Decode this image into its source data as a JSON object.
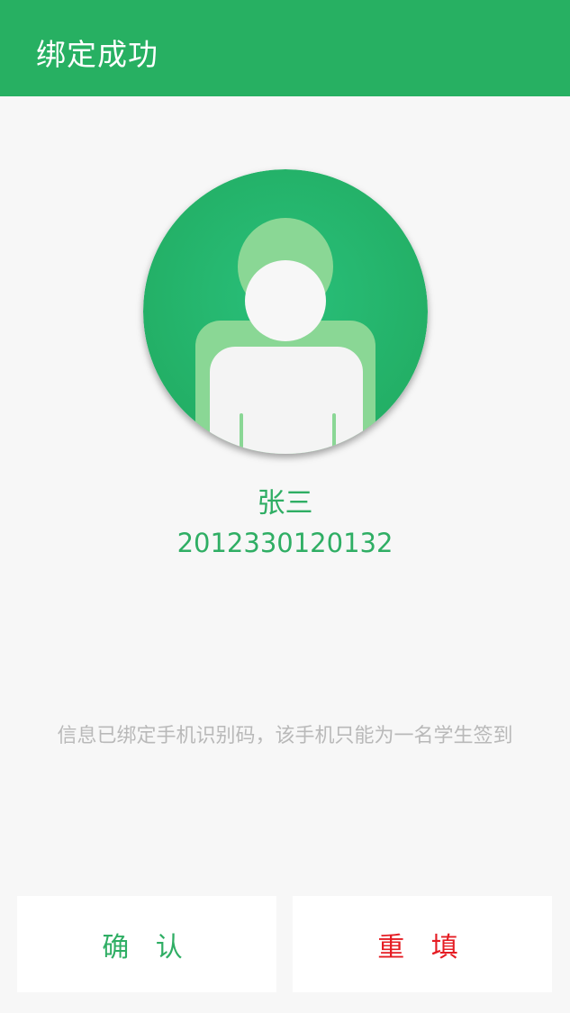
{
  "app_bar": {
    "title": "绑定成功"
  },
  "profile": {
    "avatar_icon": "user-avatar-icon",
    "name": "张三",
    "student_id": "2012330120132"
  },
  "notice": "信息已绑定手机识别码，该手机只能为一名学生签到",
  "actions": {
    "confirm_label": "确 认",
    "refill_label": "重 填"
  },
  "colors": {
    "primary": "#27b062",
    "text_green": "#2fae64",
    "danger": "#e51c23",
    "hint": "#b9b9b9",
    "background": "#f7f7f7"
  }
}
